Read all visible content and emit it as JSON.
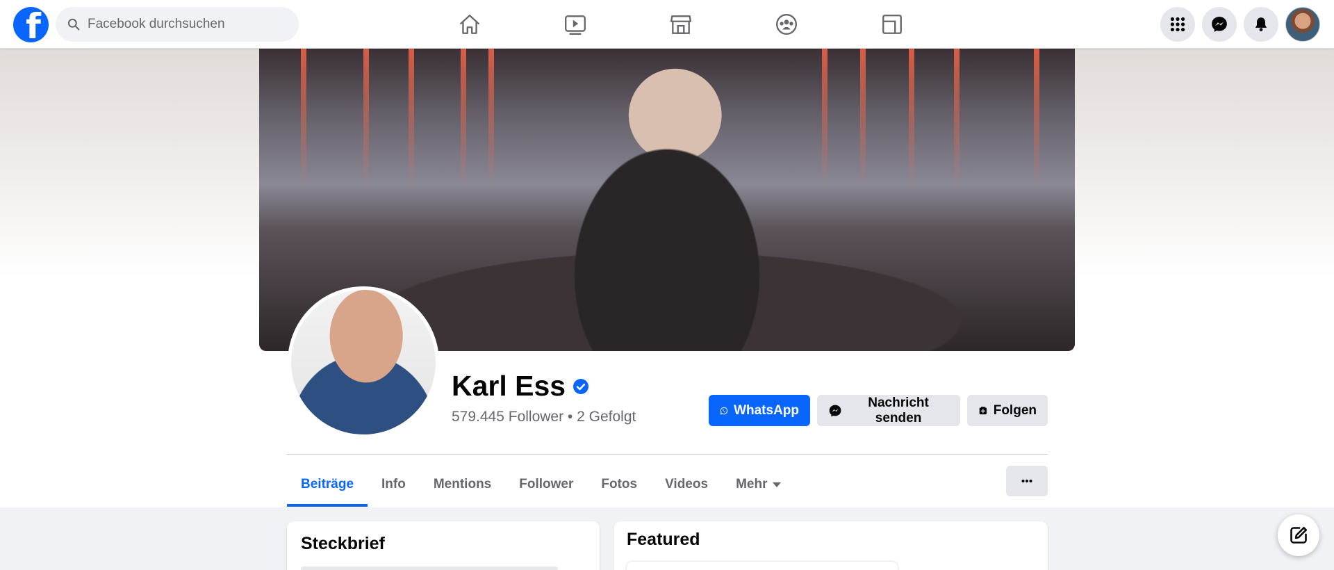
{
  "topbar": {
    "logo_letter": "f",
    "search": {
      "placeholder": "Facebook durchsuchen"
    },
    "nav": [
      {
        "name": "home-icon"
      },
      {
        "name": "video-icon"
      },
      {
        "name": "marketplace-icon"
      },
      {
        "name": "groups-icon"
      },
      {
        "name": "gaming-icon"
      }
    ],
    "right": [
      "menu-grid-icon",
      "messenger-icon",
      "notifications-icon",
      "account-avatar"
    ]
  },
  "profile": {
    "name": "Karl Ess",
    "verified": true,
    "stats": "579.445 Follower • 2 Gefolgt",
    "actions": {
      "whatsapp": "WhatsApp",
      "message": "Nachricht senden",
      "follow": "Folgen"
    }
  },
  "tabs": [
    {
      "label": "Beiträge",
      "active": true
    },
    {
      "label": "Info"
    },
    {
      "label": "Mentions"
    },
    {
      "label": "Follower"
    },
    {
      "label": "Fotos"
    },
    {
      "label": "Videos"
    },
    {
      "label": "Mehr"
    }
  ],
  "cards": {
    "steckbrief": {
      "title": "Steckbrief"
    },
    "featured": {
      "title": "Featured"
    }
  },
  "colors": {
    "accent": "#0866ff",
    "secondary_button": "#e4e6eb",
    "muted_text": "#65676b",
    "page_bg": "#f0f2f5"
  }
}
